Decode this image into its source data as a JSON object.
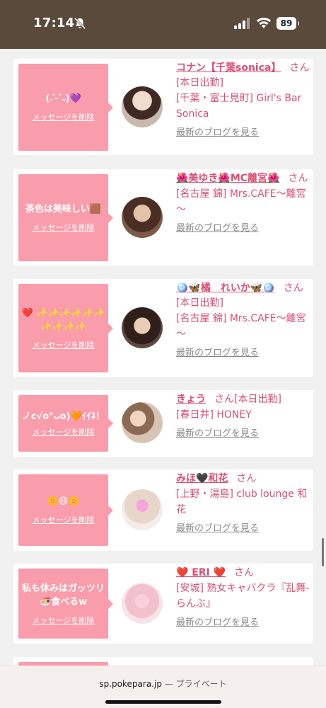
{
  "status_bar": {
    "time": "17:14",
    "battery": "89"
  },
  "browser": {
    "url": "sp.pokepara.jp",
    "mode": "— プライベート"
  },
  "cards": [
    {
      "message": "(˶ ̇ ̵ ̇˶)💜",
      "delete_label": "メッセージを削除",
      "name": "コナン【千葉sonica】",
      "suffix": "さん[本日出勤]",
      "shop": "[千葉・富士見町] Girl's Bar Sonica",
      "blog_link": "最新のブログを見る"
    },
    {
      "message": "茶色は美味しい🟫",
      "delete_label": "メッセージを削除",
      "name": "🌺美ゆき🌺MC離宮🌺",
      "suffix": "さん",
      "shop": "[名古屋 錦] Mrs.CAFE～離宮～",
      "blog_link": "最新のブログを見る"
    },
    {
      "message": "❤️ ✨✨✨✨✨✨ ✨✨✨✨",
      "delete_label": "メッセージを削除",
      "name": "🪩🦋橘　れいか🦋🪩",
      "suffix": "さん[本日出勤]",
      "shop": "[名古屋 錦] Mrs.CAFE～離宮～",
      "blog_link": "最新のブログを見る"
    },
    {
      "message": "ノc√o°ᴗo)🧡ｲｲﾈ！",
      "delete_label": "メッセージを削除",
      "name": "きょう",
      "suffix": "さん[本日出勤]",
      "shop": "[春日井] HONEY",
      "blog_link": "最新のブログを見る"
    },
    {
      "message": "🌼😆🌼",
      "delete_label": "メッセージを削除",
      "name": "みほ🖤和花",
      "suffix": "さん",
      "shop": "[上野・湯島] club lounge 和花",
      "blog_link": "最新のブログを見る"
    },
    {
      "message": "私も休みはガッツリ🍜食べるw",
      "delete_label": "メッセージを削除",
      "name": "❤️ ERI ❤️",
      "suffix": "さん",
      "shop": "[安城] 熟女キャバクラ『乱舞-らんぶ』",
      "blog_link": "最新のブログを見る"
    }
  ],
  "colors": {
    "accent": "#d94f73",
    "bubble": "#f99cab",
    "status_bar": "#5a4a3c"
  }
}
